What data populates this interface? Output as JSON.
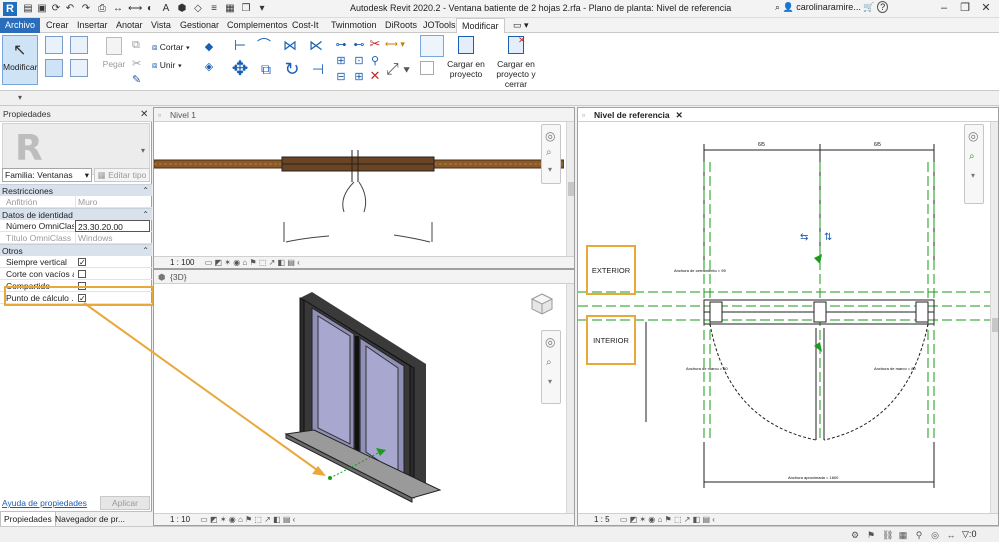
{
  "app": {
    "logo": "R",
    "title": "Autodesk Revit 2020.2 - Ventana batiente de 2 hojas 2.rfa - Plano de planta: Nivel de referencia",
    "user": "carolinaramire...",
    "help_icon": "?"
  },
  "tabs": [
    {
      "label": "Archivo"
    },
    {
      "label": "Crear"
    },
    {
      "label": "Insertar"
    },
    {
      "label": "Anotar"
    },
    {
      "label": "Vista"
    },
    {
      "label": "Gestionar"
    },
    {
      "label": "Complementos"
    },
    {
      "label": "Cost-It"
    },
    {
      "label": "Twinmotion"
    },
    {
      "label": "DiRoots"
    },
    {
      "label": "JOTools"
    },
    {
      "label": "Modificar"
    }
  ],
  "ribbon": {
    "modify_label": "Modificar",
    "paste_label": "Pegar",
    "cut_label": "Cortar",
    "join_label": "Unir",
    "load_label_1": "Cargar en",
    "load_label_2": "proyecto",
    "load_close_label_1": "Cargar en",
    "load_close_label_2": "proyecto y cerrar"
  },
  "properties": {
    "title": "Propiedades",
    "family": "Familia: Ventanas",
    "edit_type": "Editar tipo",
    "categories": {
      "constraints": "Restricciones",
      "identity": "Datos de identidad",
      "other": "Otros"
    },
    "rows": {
      "host": {
        "name": "Anfitrión",
        "value": "Muro"
      },
      "omniclass_number": {
        "name": "Número OmniClass",
        "value": "23.30.20.00"
      },
      "omniclass_title": {
        "name": "Título OmniClass",
        "value": "Windows"
      },
      "always_vertical": {
        "name": "Siempre vertical",
        "checked": "✓"
      },
      "cut_with_voids": {
        "name": "Corte con vacíos a...",
        "checked": ""
      },
      "shared": {
        "name": "Compartido",
        "checked": ""
      },
      "room_calc_point": {
        "name": "Punto de cálculo ...",
        "checked": "✓"
      }
    },
    "help_link": "Ayuda de propiedades",
    "apply": "Aplicar"
  },
  "bottom_tabs": [
    {
      "label": "Propiedades"
    },
    {
      "label": "Navegador de pr..."
    }
  ],
  "views": {
    "level1": {
      "title": "Nivel 1",
      "scale": "1 : 100"
    },
    "view3d": {
      "title": "{3D}",
      "scale": "1 : 10"
    },
    "reference": {
      "title": "Nivel de referencia",
      "scale": "1 : 5"
    }
  },
  "drawing": {
    "dim_left": "6/5",
    "dim_right": "6/5",
    "exterior": "EXTERIOR",
    "interior": "INTERIOR",
    "dim_bottom": "Anchura aproximada = 1600",
    "label_rough_width": "Anchura de cerramiento = 95",
    "label_frame_left": "Anchura de marco = 80",
    "label_frame_right": "Anchura de marco = 80"
  },
  "status": {
    "filter": "0"
  },
  "colors": {
    "accent": "#e8a83a",
    "tab_file": "#2a6ebb",
    "ref_green": "#1a9b1a",
    "wood": "#8b5a2b"
  }
}
